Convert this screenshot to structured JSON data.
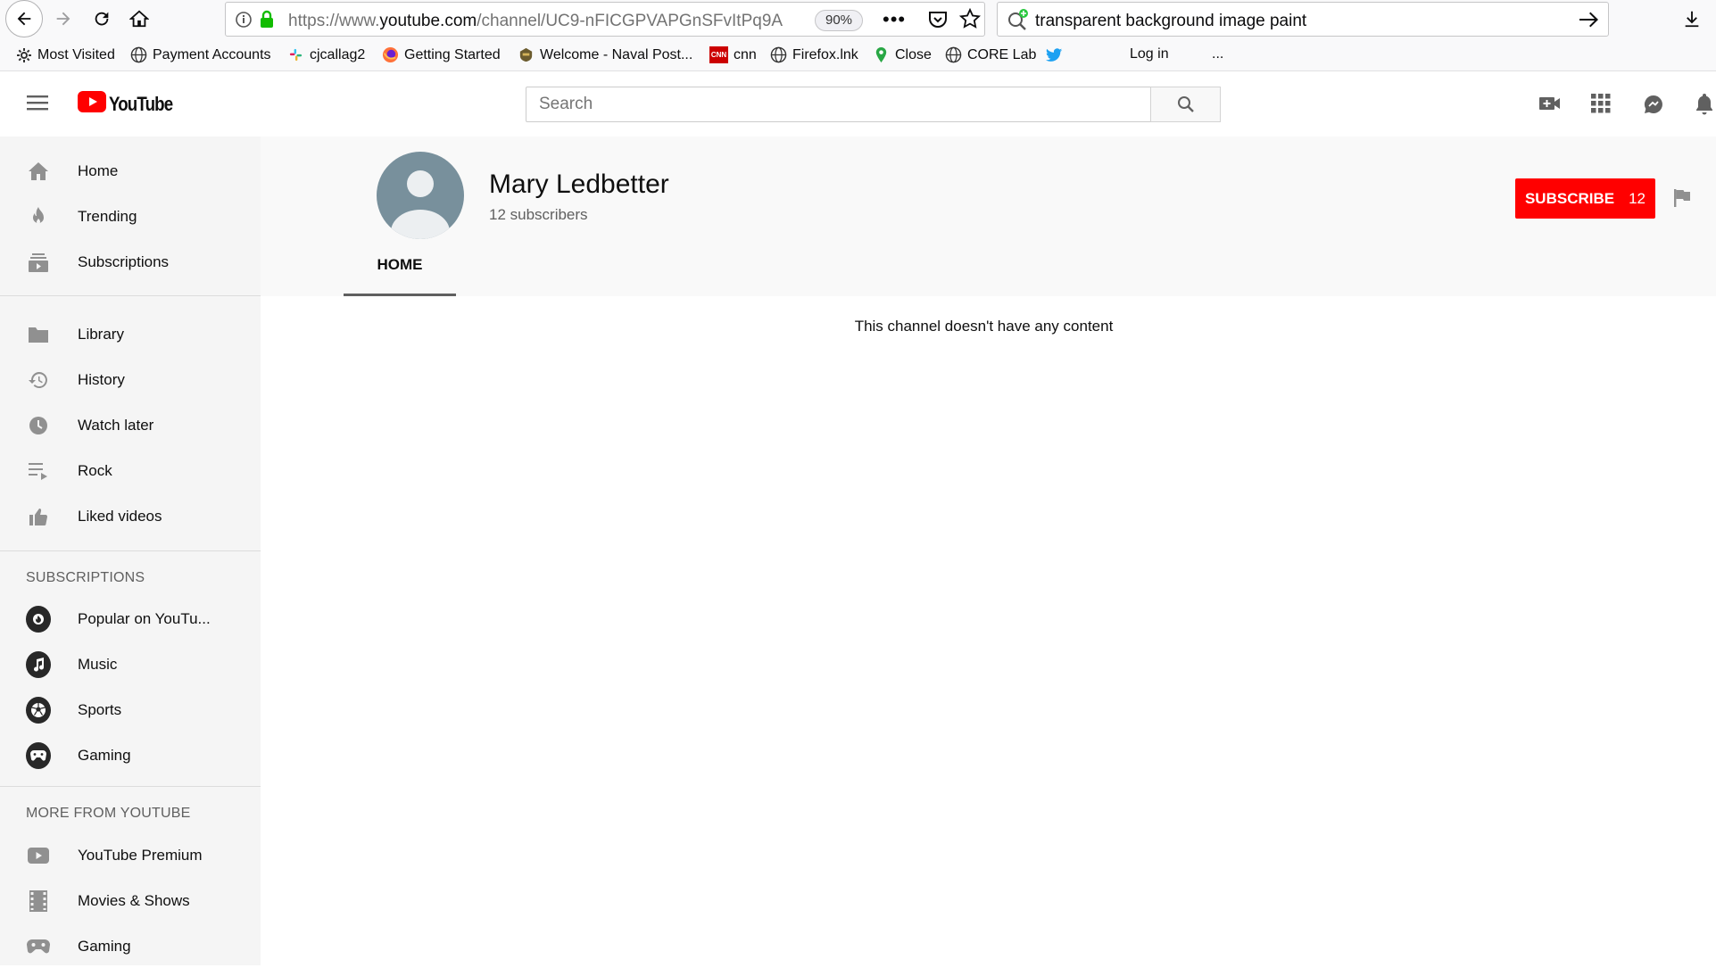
{
  "browser": {
    "url_prefix": "https://www.",
    "url_domain": "youtube.com",
    "url_path": "/channel/UC9-nFICGPVAPGnSFvItPq9A",
    "zoom": "90%",
    "search_query": "transparent background image paint",
    "bookmarks": [
      {
        "label": "Most Visited",
        "icon": "gear-icon"
      },
      {
        "label": "Payment Accounts",
        "icon": "globe-icon"
      },
      {
        "label": "cjcallag2",
        "icon": "slack-icon"
      },
      {
        "label": "Getting Started",
        "icon": "firefox-icon"
      },
      {
        "label": "Welcome - Naval Post...",
        "icon": "naval-icon"
      },
      {
        "label": "cnn",
        "icon": "cnn-icon"
      },
      {
        "label": "Firefox.lnk",
        "icon": "globe-icon"
      },
      {
        "label": "Close",
        "icon": "pin-icon"
      },
      {
        "label": "CORE Lab",
        "icon": "globe-icon"
      },
      {
        "label": "",
        "icon": "twitter-icon"
      },
      {
        "label": "Log in",
        "icon": ""
      },
      {
        "label": "...",
        "icon": ""
      }
    ]
  },
  "header": {
    "logo_text": "YouTube",
    "search_placeholder": "Search"
  },
  "sidebar": {
    "main": [
      {
        "label": "Home",
        "icon": "home-icon"
      },
      {
        "label": "Trending",
        "icon": "flame-icon"
      },
      {
        "label": "Subscriptions",
        "icon": "subscriptions-icon"
      }
    ],
    "library": [
      {
        "label": "Library",
        "icon": "folder-icon"
      },
      {
        "label": "History",
        "icon": "history-icon"
      },
      {
        "label": "Watch later",
        "icon": "clock-icon"
      },
      {
        "label": "Rock",
        "icon": "playlist-icon"
      },
      {
        "label": "Liked videos",
        "icon": "thumbs-up-icon"
      }
    ],
    "subscriptions_heading": "SUBSCRIPTIONS",
    "subscriptions": [
      {
        "label": "Popular on YouTu...",
        "icon": "popular-icon"
      },
      {
        "label": "Music",
        "icon": "music-icon"
      },
      {
        "label": "Sports",
        "icon": "sports-icon"
      },
      {
        "label": "Gaming",
        "icon": "gaming-icon"
      }
    ],
    "more_heading": "MORE FROM YOUTUBE",
    "more": [
      {
        "label": "YouTube Premium",
        "icon": "youtube-premium-icon"
      },
      {
        "label": "Movies & Shows",
        "icon": "film-icon"
      },
      {
        "label": "Gaming",
        "icon": "gamepad-icon"
      }
    ]
  },
  "channel": {
    "name": "Mary Ledbetter",
    "subscribers": "12 subscribers",
    "tab_home": "HOME",
    "subscribe_label": "SUBSCRIBE",
    "subscribe_count": "12",
    "empty_message": "This channel doesn't have any content"
  },
  "colors": {
    "accent": "#ff0000",
    "sidebar_bg": "#f5f5f5",
    "avatar_bg": "#78909c"
  }
}
